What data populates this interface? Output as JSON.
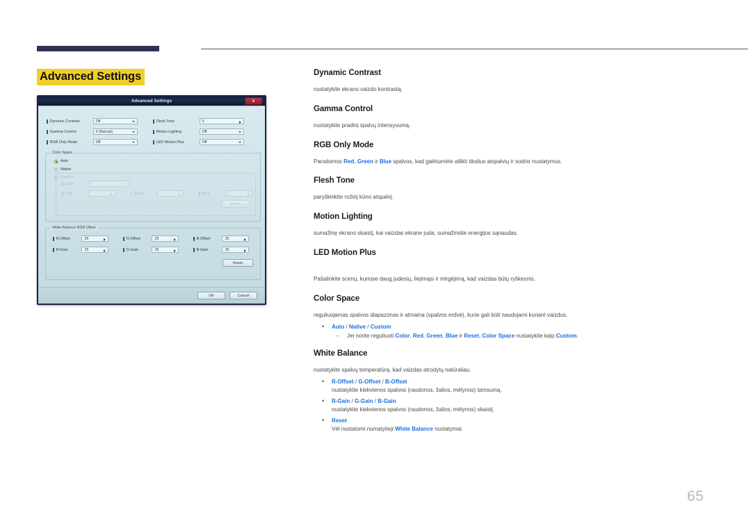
{
  "page": {
    "number": "65",
    "title": "Advanced Settings",
    "title_highlight_color": "#f0cf2a",
    "accent_blue": "#1b6ee0",
    "rule_color": "#2f3156"
  },
  "dialog": {
    "title": "Advanced Settings",
    "close_label": "x",
    "settings": [
      {
        "label": "Dynamic Contrast",
        "value": "Off",
        "control": "dropdown"
      },
      {
        "label": "Flesh Tone",
        "value": "0",
        "control": "spinner"
      },
      {
        "label": "Gamma Control",
        "value": "0 (Natural)",
        "control": "dropdown"
      },
      {
        "label": "Motion Lighting",
        "value": "Off",
        "control": "dropdown"
      },
      {
        "label": "RGB Only Mode",
        "value": "Off",
        "control": "dropdown"
      },
      {
        "label": "LED Motion Plus",
        "value": "Off",
        "control": "dropdown"
      }
    ],
    "color_space": {
      "group_title": "Color Space",
      "options": [
        {
          "label": "Auto",
          "selected": true
        },
        {
          "label": "Native",
          "selected": false
        },
        {
          "label": "Custom",
          "selected": false
        }
      ],
      "custom": {
        "color_label": "Color",
        "color_value": "",
        "red_label": "Red",
        "red_value": "",
        "green_label": "Green",
        "green_value": "",
        "blue_label": "Blue",
        "blue_value": "",
        "reset_label": "Reset"
      }
    },
    "white_balance": {
      "group_title": "White Balance RGB Offset",
      "fields": [
        {
          "label": "R-Offset",
          "value": "25"
        },
        {
          "label": "G-Offset",
          "value": "25"
        },
        {
          "label": "B-Offset",
          "value": "25"
        },
        {
          "label": "R-Gain",
          "value": "25"
        },
        {
          "label": "G-Gain",
          "value": "25"
        },
        {
          "label": "B-Gain",
          "value": "25"
        }
      ],
      "reset_label": "Reset"
    },
    "footer": {
      "ok_label": "OK",
      "cancel_label": "Cancel"
    }
  },
  "sections": {
    "dynamic_contrast": {
      "title": "Dynamic Contrast",
      "desc": "nustatykite ekrano vaizdo kontrastą."
    },
    "gamma_control": {
      "title": "Gamma Control",
      "desc": "nustatykite pradinį spalvų intensyvumą."
    },
    "rgb_only_mode": {
      "title": "RGB Only Mode",
      "desc_1": "Parodomos ",
      "em_red": "Red",
      "desc_2": ", ",
      "em_green": "Green",
      "desc_3": " ir ",
      "em_blue": "Blue",
      "desc_4": " spalvos, kad galėtumėte atlikti tikslius atspalvių ir sodrio nustatymus."
    },
    "flesh_tone": {
      "title": "Flesh Tone",
      "desc": "paryškinkite rožinį kūno atspalvį."
    },
    "motion_lighting": {
      "title": "Motion Lighting",
      "desc": "sumažinę ekrano skaistį, kai vaizdas ekrane juda, sumažinsite energijos sąnaudas."
    },
    "led_motion_plus": {
      "title": "LED Motion Plus",
      "desc": "Pašalinkite scenų, kuriose daug judesių, liejimąsi ir mirgėjimą, kad vaizdas būtų ryškesnis."
    },
    "color_space": {
      "title": "Color Space",
      "desc": "reguliuojamas spalvos diapazonas ir atmaina (spalvos erdvė), kurie gali būti naudojami kuriant vaizdus.",
      "bullet_auto": "Auto",
      "bullet_native": "Native",
      "bullet_custom": "Custom",
      "sub_1": "Jei norite reguliuoti ",
      "sub_color": "Color",
      "sub_2": ", ",
      "sub_red": "Red",
      "sub_3": ", ",
      "sub_green": "Green",
      "sub_4": ", ",
      "sub_blue": "Blue",
      "sub_5": " ir ",
      "sub_reset": "Reset",
      "sub_6": ", ",
      "sub_colorspace": "Color Space",
      "sub_7": " nustatykite kaip ",
      "sub_custom": "Custom",
      "sub_8": "."
    },
    "white_balance": {
      "title": "White Balance",
      "desc": "nustatykite spalvų temperatūrą, kad vaizdas atrodytų natūraliau.",
      "b1_r": "R-Offset",
      "b1_g": "G-Offset",
      "b1_b": "B-Offset",
      "b1_desc": "nustatykite kiekvienos spalvos (raudonos, žalios, mėlynos) tamsumą.",
      "b2_r": "R-Gain",
      "b2_g": "G-Gain",
      "b2_b": "B-Gain",
      "b2_desc": "nustatykite kiekvienos spalvos (raudonos, žalios, mėlynos) skaistį.",
      "b3_reset": "Reset",
      "b3_desc_1": "Vėl nustatomi numatytieji ",
      "b3_em": "White Balance",
      "b3_desc_2": " nustatymai."
    }
  }
}
